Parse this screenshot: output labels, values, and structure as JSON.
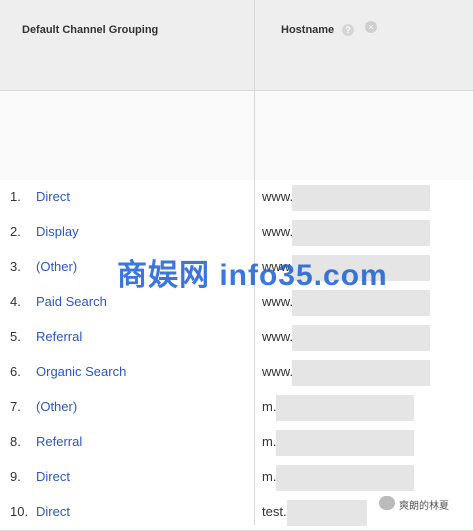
{
  "header": {
    "channel_label": "Default Channel Grouping",
    "hostname_label": "Hostname",
    "help_icon": "?",
    "close_icon": "×"
  },
  "rows": [
    {
      "num": "1.",
      "channel": "Direct",
      "host": "www."
    },
    {
      "num": "2.",
      "channel": "Display",
      "host": "www."
    },
    {
      "num": "3.",
      "channel": "(Other)",
      "host": "www."
    },
    {
      "num": "4.",
      "channel": "Paid Search",
      "host": "www."
    },
    {
      "num": "5.",
      "channel": "Referral",
      "host": "www."
    },
    {
      "num": "6.",
      "channel": "Organic Search",
      "host": "www."
    },
    {
      "num": "7.",
      "channel": "(Other)",
      "host": "m."
    },
    {
      "num": "8.",
      "channel": "Referral",
      "host": "m."
    },
    {
      "num": "9.",
      "channel": "Direct",
      "host": "m."
    },
    {
      "num": "10.",
      "channel": "Direct",
      "host": "test."
    }
  ],
  "watermark": "商娱网 info35.com",
  "credit": "爽朗的林夏",
  "colors": {
    "link": "#2a56c6",
    "header_bg": "#eeeeee",
    "watermark": "#1a5fd8"
  }
}
